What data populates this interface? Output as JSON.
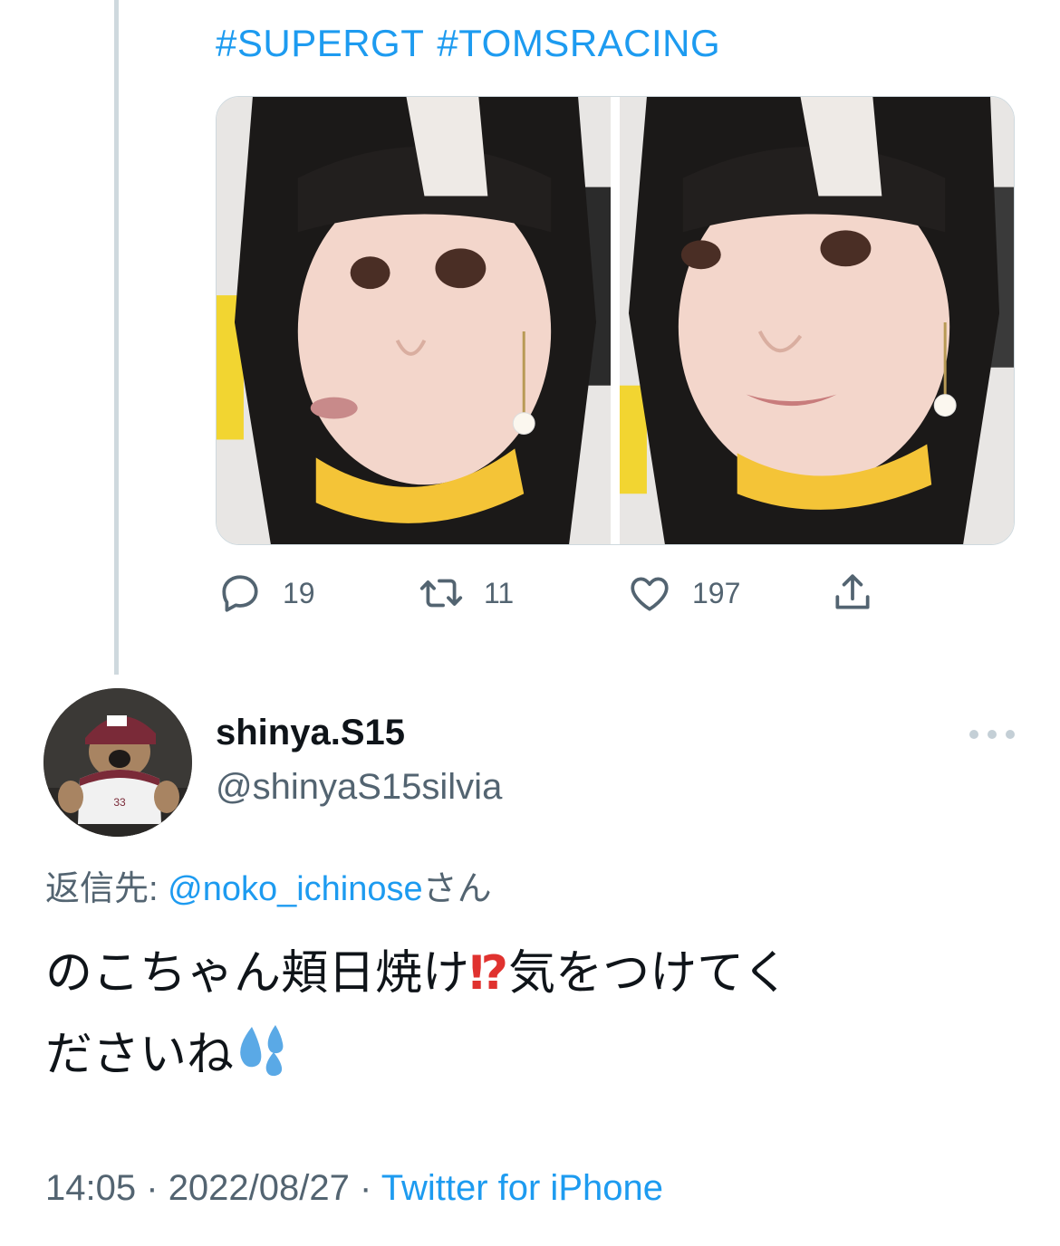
{
  "parent_tweet": {
    "hashtags": [
      "#SUPERGT",
      "#TOMSRACING"
    ],
    "media": [
      {
        "name": "photo-1"
      },
      {
        "name": "photo-2"
      }
    ],
    "counts": {
      "replies": "19",
      "retweets": "11",
      "likes": "197"
    }
  },
  "reply_tweet": {
    "display_name": "shinya.S15",
    "handle": "@shinyaS15silvia",
    "reply_prefix": "返信先:",
    "reply_mention": "@noko_ichinose",
    "reply_suffix": "さん",
    "text_line1_part1": "のこちゃん頬日焼け",
    "text_emoji": "⁉",
    "text_line1_part2": "気をつけてく",
    "text_line2": "ださいね",
    "time": "14:05",
    "separator": "·",
    "date": "2022/08/27",
    "source": "Twitter for iPhone"
  },
  "colors": {
    "link": "#1d9bf0",
    "muted": "#536471",
    "text": "#0f1419",
    "thread_line": "#cfd9de"
  }
}
